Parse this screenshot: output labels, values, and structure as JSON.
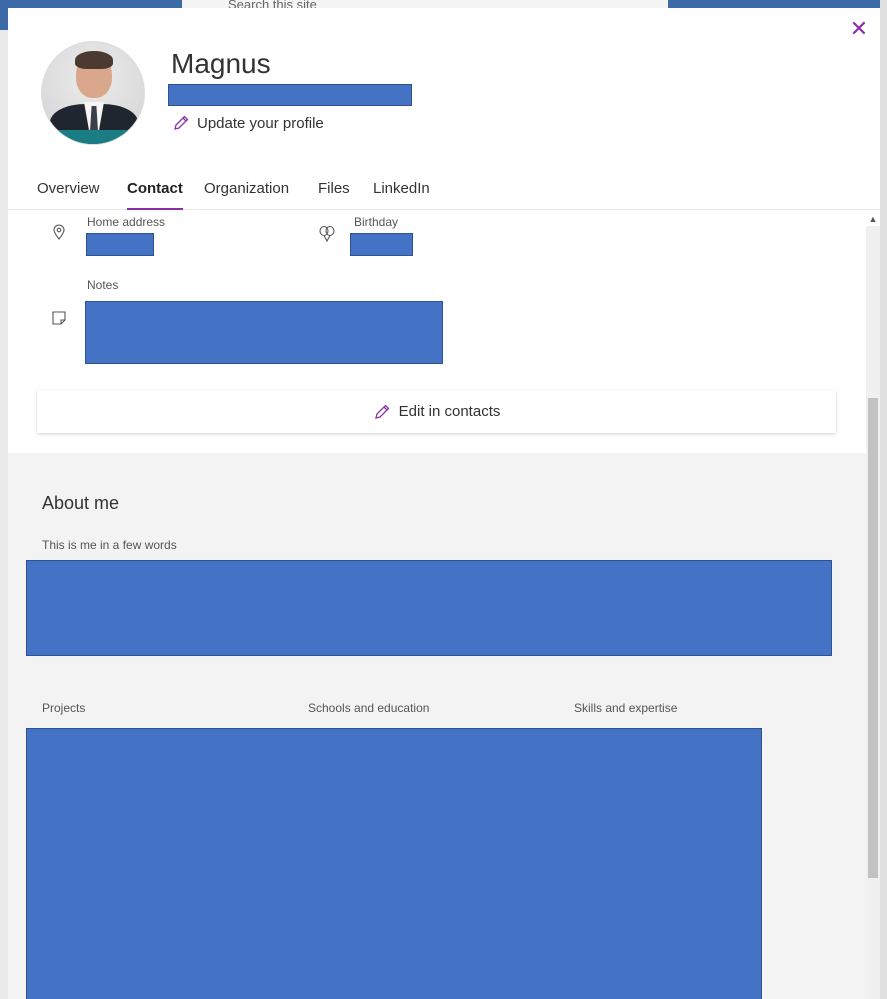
{
  "background": {
    "search_placeholder": "Search this site"
  },
  "profile": {
    "name": "Magnus",
    "update_link": "Update your profile"
  },
  "tabs": [
    {
      "label": "Overview",
      "active": false
    },
    {
      "label": "Contact",
      "active": true
    },
    {
      "label": "Organization",
      "active": false
    },
    {
      "label": "Files",
      "active": false
    },
    {
      "label": "LinkedIn",
      "active": false
    }
  ],
  "contact": {
    "home_address_label": "Home address",
    "birthday_label": "Birthday",
    "notes_label": "Notes",
    "edit_button": "Edit in contacts"
  },
  "about": {
    "title": "About me",
    "intro_label": "This is me in a few words",
    "projects_label": "Projects",
    "schools_label": "Schools and education",
    "skills_label": "Skills and expertise"
  },
  "colors": {
    "accent": "#8a2fa8",
    "redaction": "#4472c4"
  }
}
